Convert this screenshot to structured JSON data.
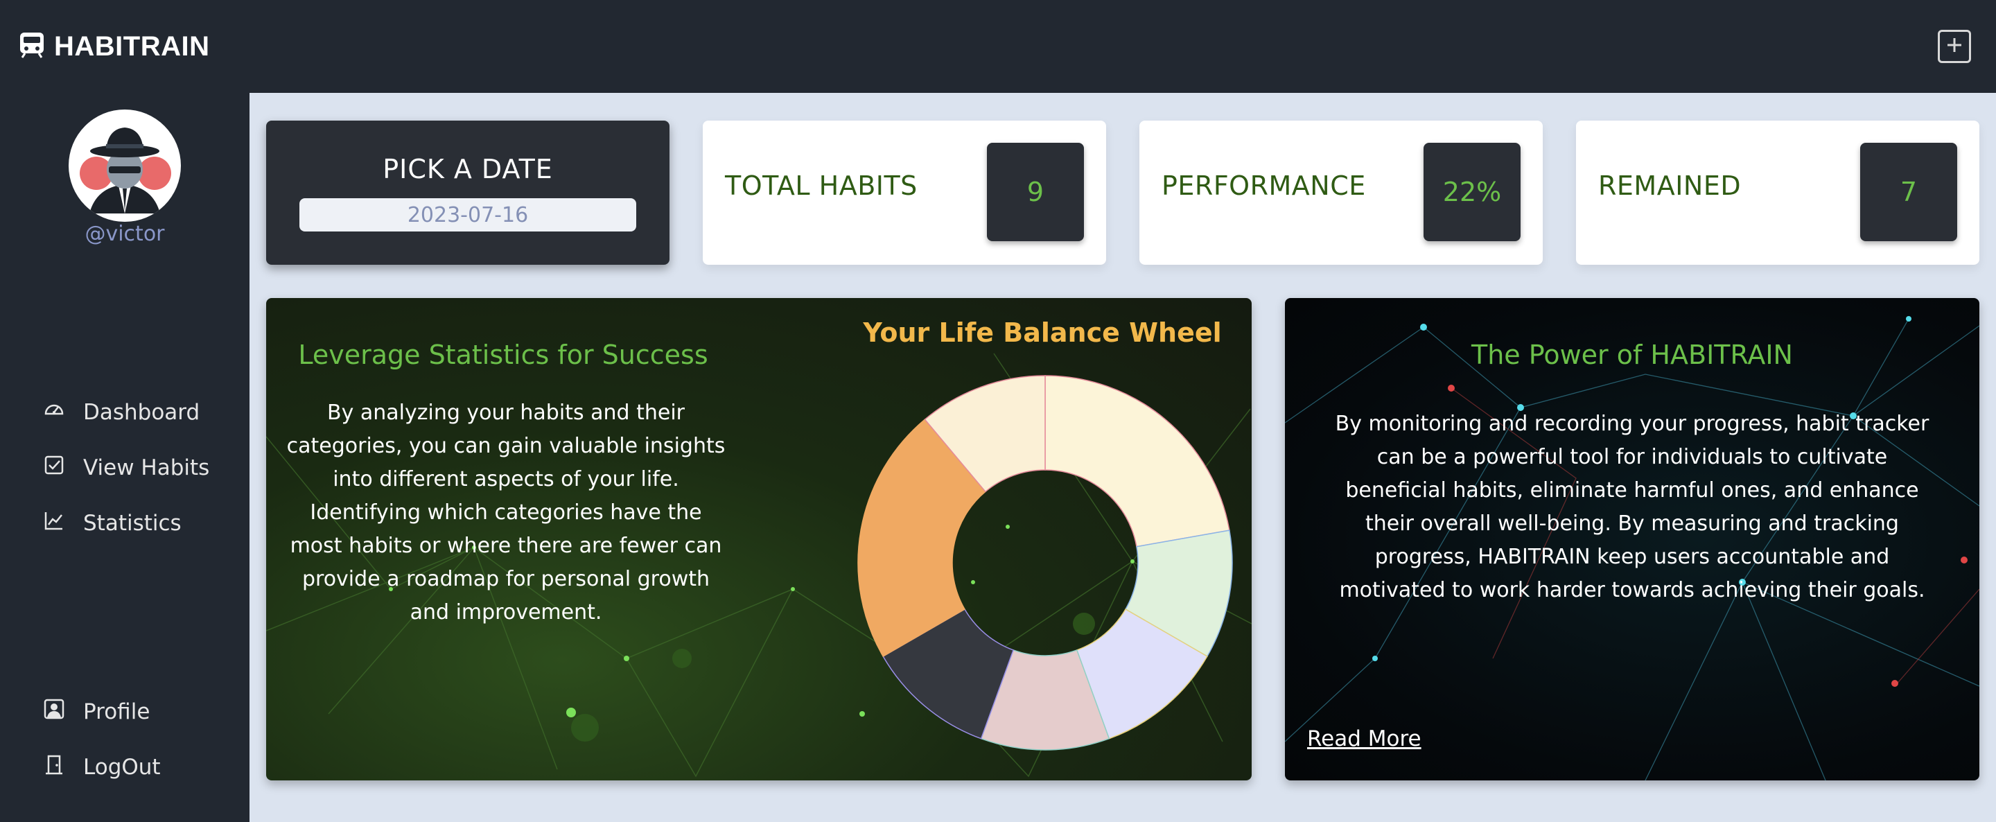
{
  "app": {
    "title": "HABITRAIN"
  },
  "header": {
    "add_icon": "plus-square-icon"
  },
  "user": {
    "username": "@victor",
    "avatar_icon": "detective-avatar"
  },
  "nav": {
    "primary": [
      {
        "label": "Dashboard",
        "icon": "speedometer-icon"
      },
      {
        "label": "View Habits",
        "icon": "check-square-icon"
      },
      {
        "label": "Statistics",
        "icon": "line-chart-icon"
      }
    ],
    "secondary": [
      {
        "label": "Profile",
        "icon": "person-square-icon"
      },
      {
        "label": "LogOut",
        "icon": "door-exit-icon"
      }
    ]
  },
  "date_picker": {
    "title": "PICK A DATE",
    "value": "2023-07-16"
  },
  "stats": [
    {
      "label": "TOTAL HABITS",
      "value": "9"
    },
    {
      "label": "PERFORMANCE",
      "value": "22%"
    },
    {
      "label": "REMAINED",
      "value": "7"
    }
  ],
  "stats_panel": {
    "heading": "Leverage Statistics for Success",
    "body": "By analyzing your habits and their categories, you can gain valuable insights into different aspects of your life. Identifying which categories have the most habits or where there are fewer can provide a roadmap for personal growth and improvement."
  },
  "power_panel": {
    "heading": "The Power of HABITRAIN",
    "body": "By monitoring and recording your progress, habit tracker can be a powerful tool for individuals to cultivate beneficial habits, eliminate harmful ones, and enhance their overall well-being. By measuring and tracking progress, HABITRAIN keep users accountable and motivated to work harder towards achieving their goals.",
    "link": "Read More"
  },
  "colors": {
    "dark": "#222831",
    "card_dark": "#2a2e35",
    "accent_green": "#6cc04a",
    "label_green": "#2f5b14",
    "wheel_title": "#f2b84b",
    "page_bg": "#dbe3ef"
  },
  "chart_data": {
    "type": "pie",
    "title": "Your Life Balance Wheel",
    "donut": true,
    "legend": "none",
    "slices": [
      {
        "value": 2,
        "color": "#fcf4d8",
        "stroke": "#e58a9a"
      },
      {
        "value": 1,
        "color": "#e0f1dc",
        "stroke": "#8ab4e8"
      },
      {
        "value": 1,
        "color": "#dfe0fa",
        "stroke": "#e8d27a"
      },
      {
        "value": 1,
        "color": "#e5cccc",
        "stroke": "#8fd0c8"
      },
      {
        "value": 1,
        "color": "#35383f",
        "stroke": "#9a8fe8"
      },
      {
        "value": 2,
        "color": "#f0a962",
        "stroke": "#f0a962"
      },
      {
        "value": 1,
        "color": "#fbf0d6",
        "stroke": "#e58a9a"
      }
    ]
  }
}
